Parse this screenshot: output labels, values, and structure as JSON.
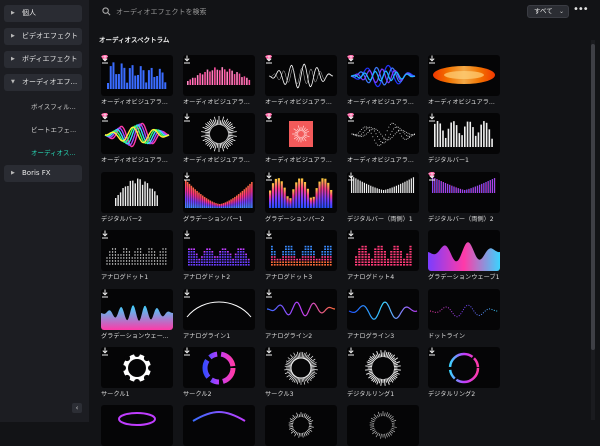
{
  "search": {
    "placeholder": "オーディオエフェクトを検索"
  },
  "filter": {
    "label": "すべて"
  },
  "sidebar": {
    "items": [
      {
        "label": "個人"
      },
      {
        "label": "ビデオエフェクト"
      },
      {
        "label": "ボディエフェクト"
      },
      {
        "label": "オーディオエフ..."
      },
      {
        "label": "Boris FX"
      }
    ],
    "subitems": [
      {
        "label": "ボイスフィル..."
      },
      {
        "label": "ビートエフェ..."
      },
      {
        "label": "オーディオス..."
      }
    ]
  },
  "section": {
    "title": "オーディオスペクトラム"
  },
  "accent_color": "#27d6b4",
  "cards": [
    {
      "label": "オーディオビジュアラ...",
      "premium": true,
      "download": true,
      "style": "bluebars"
    },
    {
      "label": "オーディオビジュアラ...",
      "premium": false,
      "download": true,
      "style": "pinkbars"
    },
    {
      "label": "オーディオビジュアラ...",
      "premium": true,
      "download": true,
      "style": "whitewave"
    },
    {
      "label": "オーディオビジュアラ...",
      "premium": true,
      "download": true,
      "style": "bluewave"
    },
    {
      "label": "オーディオビジュアラ...",
      "premium": false,
      "download": true,
      "style": "orangeglow"
    },
    {
      "label": "オーディオビジュアラ...",
      "premium": true,
      "download": true,
      "style": "rainbowwave"
    },
    {
      "label": "オーディオビジュアラ...",
      "premium": false,
      "download": true,
      "style": "radial"
    },
    {
      "label": "オーディオビジュアラ...",
      "premium": true,
      "download": true,
      "style": "redbox"
    },
    {
      "label": "オーディオビジュアラ...",
      "premium": true,
      "download": true,
      "style": "dotwave"
    },
    {
      "label": "デジタルバー1",
      "premium": false,
      "download": true,
      "style": "whitebars"
    },
    {
      "label": "デジタルバー2",
      "premium": false,
      "download": false,
      "style": "whitebars2"
    },
    {
      "label": "グラデーションバー1",
      "premium": false,
      "download": true,
      "style": "gradvalley"
    },
    {
      "label": "グラデーションバー2",
      "premium": false,
      "download": true,
      "style": "gradbars"
    },
    {
      "label": "デジタルバー（両側）1",
      "premium": false,
      "download": true,
      "style": "mirror"
    },
    {
      "label": "デジタルバー（両側）2",
      "premium": true,
      "download": true,
      "style": "gradmirror"
    },
    {
      "label": "アナログドット1",
      "premium": false,
      "download": true,
      "style": "dots"
    },
    {
      "label": "アナログドット2",
      "premium": false,
      "download": true,
      "style": "purpledots"
    },
    {
      "label": "アナログドット3",
      "premium": false,
      "download": true,
      "style": "colordots"
    },
    {
      "label": "アナログドット4",
      "premium": false,
      "download": true,
      "style": "pinkdots"
    },
    {
      "label": "グラデーションウェーブ1",
      "premium": false,
      "download": false,
      "style": "gradwave"
    },
    {
      "label": "グラデーションウェー...",
      "premium": false,
      "download": true,
      "style": "cyanwave"
    },
    {
      "label": "アナログライン1",
      "premium": false,
      "download": true,
      "style": "whiteline"
    },
    {
      "label": "アナログライン2",
      "premium": false,
      "download": true,
      "style": "purpleline"
    },
    {
      "label": "アナログライン3",
      "premium": false,
      "download": true,
      "style": "blueline"
    },
    {
      "label": "ドットライン",
      "premium": false,
      "download": false,
      "style": "dotline"
    },
    {
      "label": "サークル1",
      "premium": false,
      "download": true,
      "style": "circle1"
    },
    {
      "label": "サークル2",
      "premium": false,
      "download": true,
      "style": "circle2"
    },
    {
      "label": "サークル3",
      "premium": false,
      "download": true,
      "style": "circle3"
    },
    {
      "label": "デジタルリング1",
      "premium": false,
      "download": true,
      "style": "ring1"
    },
    {
      "label": "デジタルリング2",
      "premium": false,
      "download": true,
      "style": "ring2"
    },
    {
      "label": "",
      "premium": false,
      "download": false,
      "style": "partial1"
    },
    {
      "label": "",
      "premium": false,
      "download": false,
      "style": "partial2"
    },
    {
      "label": "",
      "premium": false,
      "download": false,
      "style": "partial3"
    },
    {
      "label": "",
      "premium": false,
      "download": false,
      "style": "partial4"
    }
  ]
}
